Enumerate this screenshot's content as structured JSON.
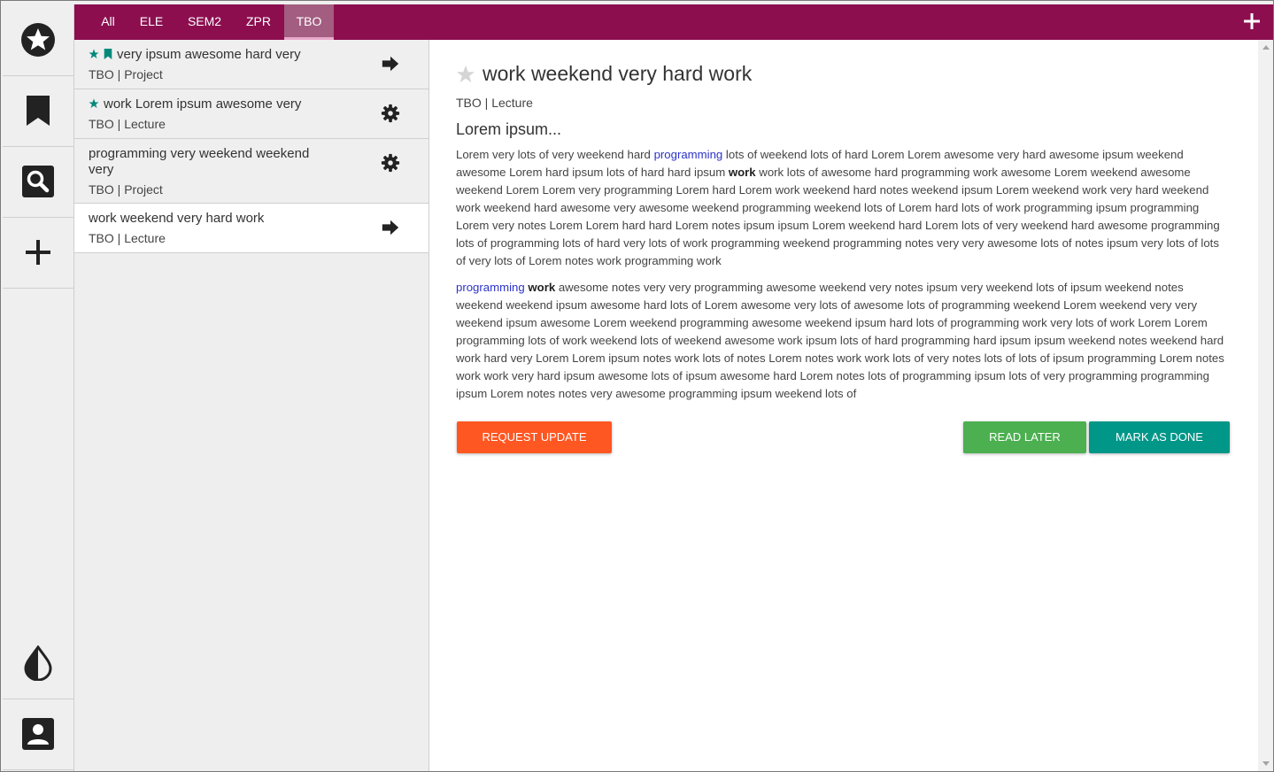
{
  "colors": {
    "primary": "#8c0e4f",
    "tab_active": "#a35d80",
    "request": "#ff5722",
    "read_later": "#4caf50",
    "mark_done": "#009688",
    "accent_star": "#00897b"
  },
  "sidebar": {
    "items": [
      {
        "name": "favorites",
        "icon": "star-circle-icon"
      },
      {
        "name": "bookmarks",
        "icon": "bookmark-icon"
      },
      {
        "name": "search",
        "icon": "search-icon"
      },
      {
        "name": "add",
        "icon": "plus-icon"
      },
      {
        "name": "theme",
        "icon": "contrast-drop-icon"
      },
      {
        "name": "account",
        "icon": "account-box-icon"
      }
    ]
  },
  "tabs": [
    {
      "label": "All"
    },
    {
      "label": "ELE"
    },
    {
      "label": "SEM2"
    },
    {
      "label": "ZPR"
    },
    {
      "label": "TBO"
    }
  ],
  "active_tab": "TBO",
  "list": [
    {
      "title": "very ipsum awesome hard very",
      "meta": "TBO | Project",
      "starred": true,
      "bookmarked": true,
      "action_icon": "arrow-right-icon"
    },
    {
      "title": "work Lorem ipsum awesome very",
      "meta": "TBO | Lecture",
      "starred": true,
      "bookmarked": false,
      "action_icon": "gear-icon"
    },
    {
      "title": "programming very weekend weekend very",
      "meta": "TBO | Project",
      "starred": false,
      "bookmarked": false,
      "action_icon": "gear-icon"
    },
    {
      "title": "work weekend very hard work",
      "meta": "TBO | Lecture",
      "starred": false,
      "bookmarked": false,
      "action_icon": "arrow-right-icon",
      "selected": true
    }
  ],
  "detail": {
    "title": "work weekend very hard work",
    "meta": "TBO | Lecture",
    "subtitle": "Lorem ipsum...",
    "para1": {
      "a": "Lorem very lots of very weekend hard ",
      "link": "programming",
      "b": " lots of weekend lots of hard Lorem Lorem awesome very hard awesome ipsum weekend awesome Lorem hard ipsum lots of hard hard ipsum ",
      "bold": "work",
      "c": " work lots of awesome hard programming work awesome Lorem weekend awesome weekend Lorem Lorem very programming Lorem hard Lorem work weekend hard notes weekend ipsum Lorem weekend work very hard weekend work weekend hard awesome very awesome weekend programming weekend lots of Lorem hard lots of work programming ipsum programming Lorem very notes Lorem Lorem hard hard Lorem notes ipsum ipsum Lorem weekend hard Lorem lots of very weekend hard awesome programming lots of programming lots of hard very lots of work programming weekend programming notes very very awesome lots of notes ipsum very lots of lots of very lots of Lorem notes work programming work"
    },
    "para2": {
      "link": "programming",
      "bold": "work",
      "c": " awesome notes very very programming awesome weekend very notes ipsum very weekend lots of ipsum weekend notes weekend weekend ipsum awesome hard lots of Lorem awesome very lots of awesome lots of programming weekend Lorem weekend very very weekend ipsum awesome Lorem weekend programming awesome weekend ipsum hard lots of programming work very lots of work Lorem Lorem programming lots of work weekend lots of weekend awesome work ipsum lots of hard programming hard ipsum ipsum weekend notes weekend hard work hard very Lorem Lorem ipsum notes work lots of notes Lorem notes work work lots of very notes lots of lots of ipsum programming Lorem notes work work very hard ipsum awesome lots of ipsum awesome hard Lorem notes lots of programming ipsum lots of very programming programming ipsum Lorem notes notes very awesome programming ipsum weekend lots of"
    },
    "buttons": {
      "request_update": "REQUEST UPDATE",
      "read_later": "READ LATER",
      "mark_done": "MARK AS DONE"
    }
  }
}
